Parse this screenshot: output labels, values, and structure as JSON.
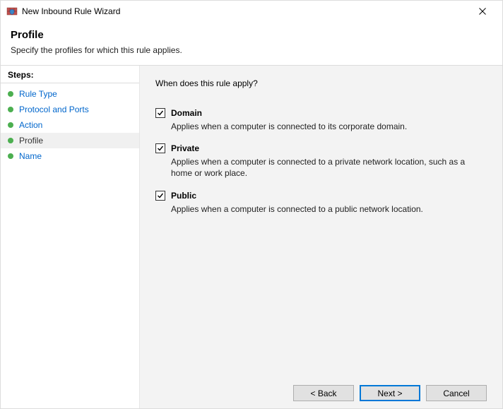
{
  "window": {
    "title": "New Inbound Rule Wizard"
  },
  "header": {
    "heading": "Profile",
    "subheading": "Specify the profiles for which this rule applies."
  },
  "steps": {
    "label": "Steps:",
    "items": [
      {
        "label": "Rule Type",
        "current": false
      },
      {
        "label": "Protocol and Ports",
        "current": false
      },
      {
        "label": "Action",
        "current": false
      },
      {
        "label": "Profile",
        "current": true
      },
      {
        "label": "Name",
        "current": false
      }
    ]
  },
  "content": {
    "question": "When does this rule apply?",
    "options": [
      {
        "label": "Domain",
        "desc": "Applies when a computer is connected to its corporate domain.",
        "checked": true
      },
      {
        "label": "Private",
        "desc": "Applies when a computer is connected to a private network location, such as a home or work place.",
        "checked": true
      },
      {
        "label": "Public",
        "desc": "Applies when a computer is connected to a public network location.",
        "checked": true
      }
    ]
  },
  "buttons": {
    "back": "< Back",
    "next": "Next >",
    "cancel": "Cancel"
  }
}
